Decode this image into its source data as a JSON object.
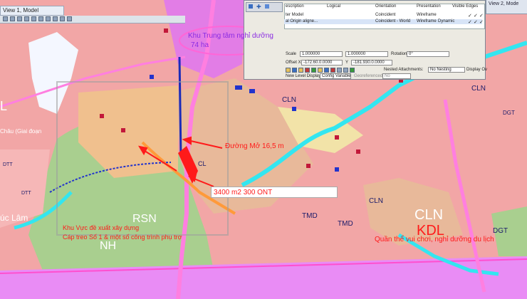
{
  "window": {
    "title": "View 1, Model",
    "right_title": "View 2, Mode"
  },
  "dialog": {
    "col_headers": [
      "escription",
      "Logical",
      "Orientation",
      "Presentation",
      "Visible Edges"
    ],
    "rows": [
      {
        "name": "ter Model",
        "orientation": "Coincident",
        "presentation": "Wireframe",
        "display": ""
      },
      {
        "name": "al Origin aligne...",
        "orientation": "Coincident - World",
        "presentation": "Wireframe",
        "display": "Dynamic"
      }
    ],
    "check": "✓",
    "scale_label": "Scale",
    "scale_x": "1.000000",
    "scale_y": "1.000000",
    "rotation_label": "Rotation",
    "rotation_value": "0°",
    "offset_label": "Offset X",
    "offset_x": "-172.60.0.0000",
    "offset_y_label": "Y",
    "offset_y": "-181.930.0.0000",
    "nested_label": "Nested Attachments:",
    "nested_value": "No Nesting",
    "display_overrides": "Display Ov",
    "new_level_label": "New Level Display:",
    "new_level_value": "Config Variable",
    "georeferenced_label": "Georeferenced:",
    "georeferenced_value": "No"
  },
  "annotations": {
    "resort_area": "Khu Trung tâm nghỉ dưỡng",
    "resort_area_size": "74 ha",
    "road": "Đường Mở 16,5 m",
    "plot": "3400 m2 300 ONT",
    "cablecar_1": "Khu Vực đề xuất xây dựng",
    "cablecar_2": "Cáp treo Số 1 & một số công trình phụ trợ",
    "park": "Quần thể vui chơi, nghỉ dưỡng du lịch",
    "chau": "Châu (Giai đoạn",
    "lam": "úc Lâm"
  },
  "zone_codes": {
    "cln_big": "CLN",
    "kdl": "KDL",
    "cln_1": "CLN",
    "cln_2": "CLN",
    "cln_3": "CLN",
    "rsn": "RSN",
    "nh": "NH",
    "tmd_1": "TMD",
    "tmd_2": "TMD",
    "dgt_1": "DGT",
    "dgt_2": "DGT",
    "dtt_1": "DTT",
    "dtt_2": "DTT",
    "cl": "CL",
    "l_left": "L"
  },
  "colors": {
    "annotation": "#ff1a1a",
    "resort_text": "#8a2be2",
    "forest_green": "#a3c98a",
    "pink_zone": "#f2a6a6",
    "cyan_road": "#33e6f0",
    "magenta_line": "#ff7fe0",
    "sea": "#e98cf5"
  }
}
